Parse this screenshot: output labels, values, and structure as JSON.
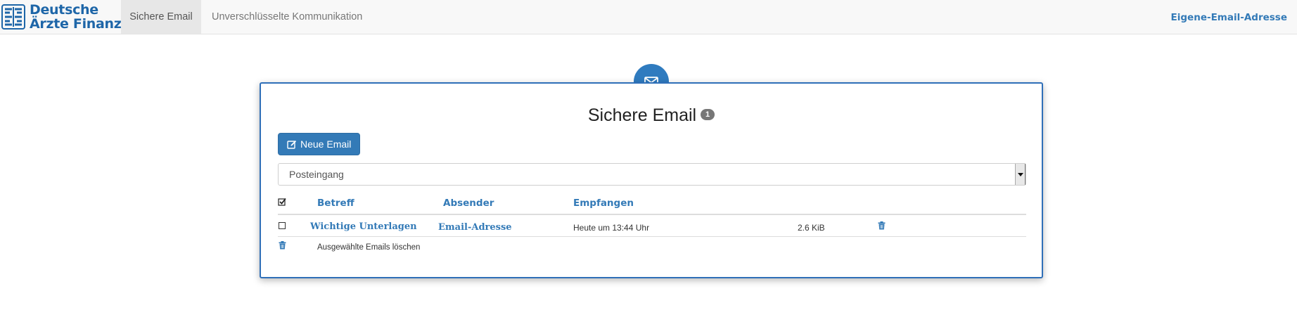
{
  "navbar": {
    "brand": {
      "line1": "Deutsche",
      "line2": "Ärzte Finanz"
    },
    "tabs": [
      {
        "label": "Sichere Email",
        "active": true
      },
      {
        "label": "Unverschlüsselte Kommunikation",
        "active": false
      }
    ],
    "right_link": "Eigene-Email-Adresse"
  },
  "panel": {
    "icon": "envelope-icon",
    "title": "Sichere Email",
    "badge_count": "1",
    "new_email_button": "Neue Email",
    "folder_select": {
      "value": "Posteingang"
    },
    "table": {
      "headers": {
        "subject": "Betreff",
        "sender": "Absender",
        "received": "Empfangen"
      },
      "rows": [
        {
          "subject": "Wichtige Unterlagen",
          "sender": "Email-Adresse",
          "received": "Heute um 13:44 Uhr",
          "size": "2.6 KiB"
        }
      ],
      "delete_selected_label": "Ausgewählte Emails löschen"
    }
  },
  "colors": {
    "primary": "#337ab7",
    "panel_border": "#2f6fb8",
    "brand": "#1e66a8"
  }
}
